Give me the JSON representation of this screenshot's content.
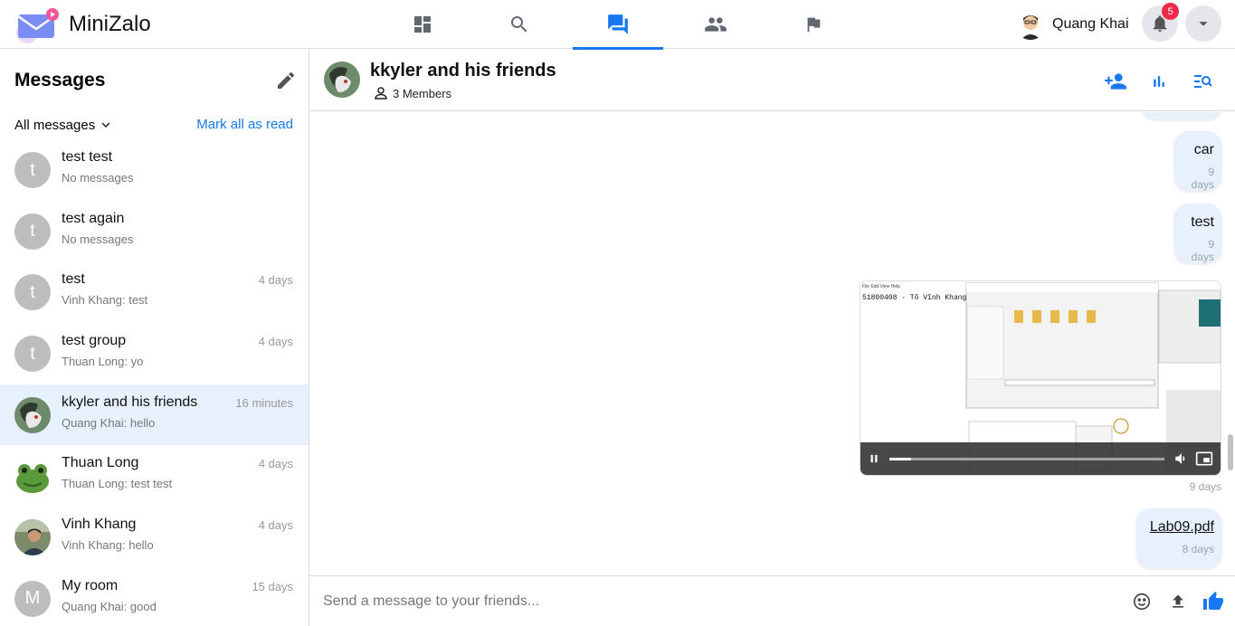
{
  "app": {
    "name": "MiniZalo"
  },
  "nav": {
    "tabs": [
      {
        "icon": "dashboard-icon"
      },
      {
        "icon": "search-icon"
      },
      {
        "icon": "chat-icon",
        "active": true
      },
      {
        "icon": "friends-icon"
      },
      {
        "icon": "flag-icon"
      }
    ],
    "user_name": "Quang Khai",
    "notification_count": "5"
  },
  "sidebar": {
    "title": "Messages",
    "filter_label": "All messages",
    "mark_all_read": "Mark all as read",
    "conversations": [
      {
        "initial": "t",
        "name": "test test",
        "last": "No messages",
        "time": ""
      },
      {
        "initial": "t",
        "name": "test again",
        "last": "No messages",
        "time": ""
      },
      {
        "initial": "t",
        "name": "test",
        "last": "Vinh Khang: test",
        "time": "4 days"
      },
      {
        "initial": "t",
        "name": "test group",
        "last": "Thuan Long: yo",
        "time": "4 days"
      },
      {
        "initial": "",
        "name": "kkyler and his friends",
        "last": "Quang Khai: hello",
        "time": "16 minutes",
        "active": true
      },
      {
        "initial": "",
        "name": "Thuan Long",
        "last": "Thuan Long: test test",
        "time": "4 days"
      },
      {
        "initial": "",
        "name": "Vinh Khang",
        "last": "Vinh Khang: hello",
        "time": "4 days"
      },
      {
        "initial": "M",
        "name": "My room",
        "last": "Quang Khai: good",
        "time": "15 days"
      }
    ]
  },
  "chat": {
    "title": "kkyler and his friends",
    "members": "3 Members",
    "messages": [
      {
        "type": "text",
        "text": "car",
        "time": "9 days"
      },
      {
        "type": "text",
        "text": "test",
        "time": "9 days"
      },
      {
        "type": "video",
        "time": "9 days",
        "progress": 0.08,
        "video_caption": "51800408 - Tô Vĩnh Khang"
      },
      {
        "type": "file",
        "text": "Lab09.pdf",
        "time": "8 days"
      }
    ],
    "composer_placeholder": "Send a message to your friends..."
  },
  "colors": {
    "accent": "#1877f2",
    "bubble": "#e7f0fd",
    "badge": "#f02849"
  }
}
